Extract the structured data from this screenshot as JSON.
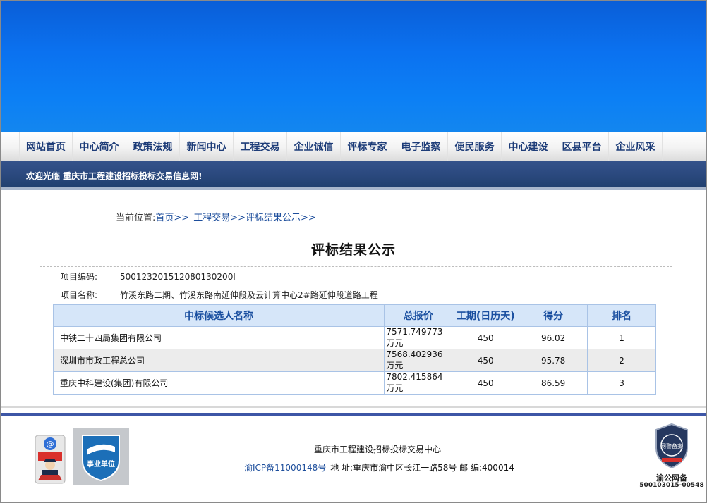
{
  "nav": {
    "items": [
      "网站首页",
      "中心简介",
      "政策法规",
      "新闻中心",
      "工程交易",
      "企业诚信",
      "评标专家",
      "电子监察",
      "便民服务",
      "中心建设",
      "区县平台",
      "企业风采"
    ]
  },
  "welcome": "欢迎光临 重庆市工程建设招标投标交易信息网!",
  "breadcrumb": {
    "prefix": "当前位置:",
    "home": "首页>>",
    "section": "工程交易>>评标结果公示>>"
  },
  "page_title": "评标结果公示",
  "project": {
    "code_label": "项目编码:",
    "code": "500123201512080130200l",
    "name_label": "项目名称:",
    "name": "竹溪东路二期、竹溪东路南延伸段及云计算中心2#路延伸段道路工程"
  },
  "table": {
    "headers": [
      "中标候选人名称",
      "总报价",
      "工期(日历天)",
      "得分",
      "排名"
    ],
    "rows": [
      {
        "company": "中铁二十四局集团有限公司",
        "price": "7571.749773万元",
        "days": "450",
        "score": "96.02",
        "rank": "1"
      },
      {
        "company": "深圳市市政工程总公司",
        "price": "7568.402936万元",
        "days": "450",
        "score": "95.78",
        "rank": "2"
      },
      {
        "company": "重庆中科建设(集团)有限公司",
        "price": "7802.415864万元",
        "days": "450",
        "score": "86.59",
        "rank": "3"
      }
    ]
  },
  "footer": {
    "org": "重庆市工程建设招标投标交易中心",
    "icp": "渝ICP备11000148号",
    "address": "地 址:重庆市渝中区长江一路58号 邮 编:400014",
    "unit_badge": "事业单位",
    "net_badge_label": "渝公网备",
    "net_badge_code": "500103015-00548",
    "net_badge_seal": "网警备案"
  },
  "colors": {
    "banner": "#0b72f0",
    "nav_text": "#1d3c78",
    "welcome_bar": "#2c4a80",
    "table_header_bg": "#d6e6f9",
    "table_header_text": "#1a4fa0",
    "link": "#1d4e9c",
    "footer_rule": "#3d56a6"
  }
}
